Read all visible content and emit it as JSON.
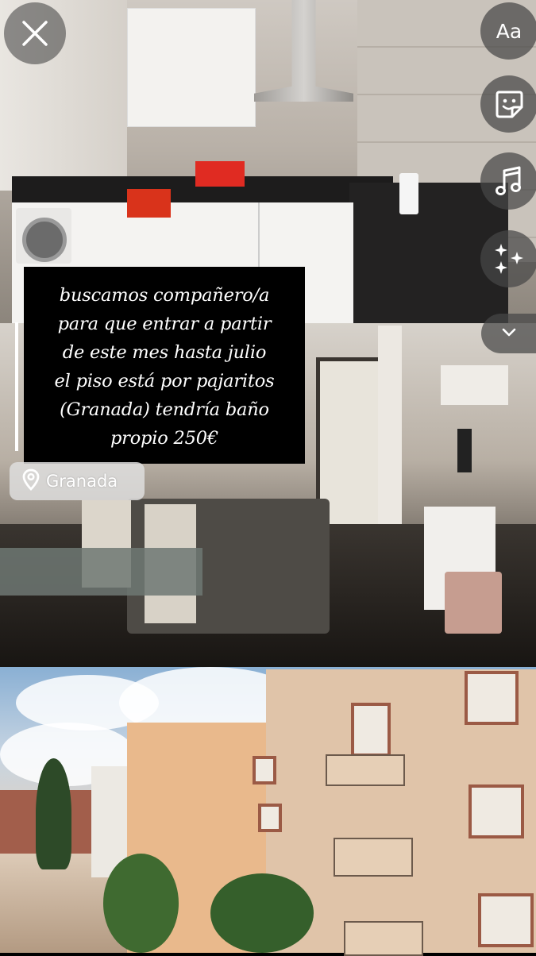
{
  "story_editor": {
    "caption": "buscamos compañero/a\npara que entrar a partir\nde este mes hasta julio\nel piso está por pajaritos\n(Granada) tendría baño\npropio 250€",
    "location_sticker": {
      "label": "Granada",
      "icon": "location-pin-icon"
    },
    "toolbar": {
      "close_icon": "close-icon",
      "text_tool_label": "Aa",
      "sticker_icon": "sticker-icon",
      "music_icon": "music-note-icon",
      "effects_icon": "sparkles-icon",
      "more_icon": "chevron-down-icon"
    },
    "colors": {
      "caption_background": "#000000",
      "caption_text": "#ffffff",
      "button_background": "#464646",
      "location_pill": "#e1e1e1"
    }
  }
}
